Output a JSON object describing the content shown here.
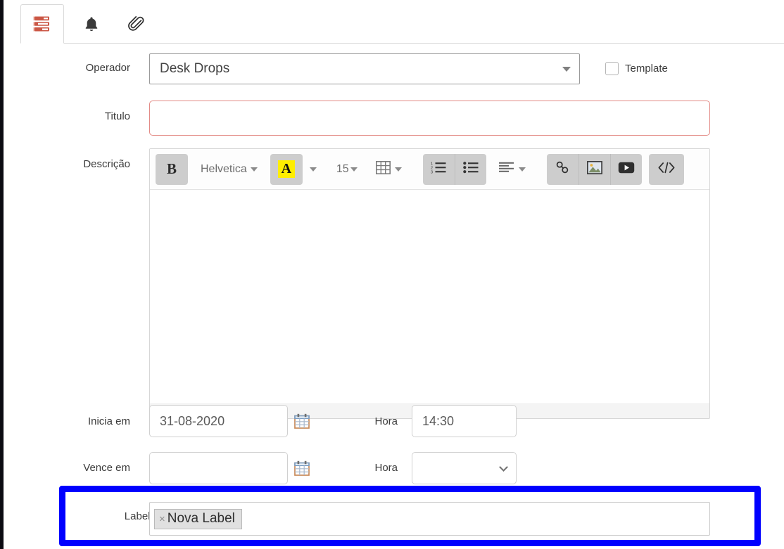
{
  "tabs": [
    {
      "id": "tab-details",
      "icon": "server-stack-icon",
      "label": "",
      "active": true
    },
    {
      "id": "tab-notifications",
      "icon": "bell-icon",
      "label": "",
      "active": false
    },
    {
      "id": "tab-attachments",
      "icon": "paperclip-icon",
      "label": "",
      "active": false
    }
  ],
  "form": {
    "operador": {
      "label": "Operador",
      "value": "Desk Drops",
      "icon": "chevron-down-icon"
    },
    "template": {
      "label": "Template",
      "checked": false
    },
    "titulo": {
      "label": "Titulo",
      "value": "",
      "placeholder": "",
      "invalid": true
    },
    "descricao": {
      "label": "Descrição",
      "content": "",
      "toolbar": {
        "bold_label": "B",
        "font_family": "Helvetica",
        "font_family_caret": "caret-down-icon",
        "text_color_glyph": "A",
        "text_color_caret": "caret-down-icon",
        "font_size": "15",
        "font_size_caret": "caret-down-icon",
        "table_icon": "table-grid-icon",
        "table_caret": "caret-down-icon",
        "ordered_list_icon": "ordered-list-icon",
        "unordered_list_icon": "unordered-list-icon",
        "align_icon": "align-left-icon",
        "align_caret": "caret-down-icon",
        "link_icon": "link-chain-icon",
        "image_icon": "image-picture-icon",
        "video_icon": "video-play-icon",
        "code_icon": "code-brackets-icon",
        "code_label": "</>"
      },
      "resize_grip": "resize-grip-icon"
    },
    "inicia_em": {
      "label": "Inicia em",
      "value": "31-08-2020",
      "calendar_icon": "calendar-icon",
      "hora_label": "Hora",
      "hora_value": "14:30"
    },
    "vence_em": {
      "label": "Vence em",
      "value": "",
      "calendar_icon": "calendar-icon",
      "hora_label": "Hora",
      "hora_value": "",
      "hora_caret": "chevron-down-icon"
    },
    "labels": {
      "label": "Labels",
      "chips": [
        {
          "remove_glyph": "×",
          "text": "Nova Label"
        }
      ]
    }
  },
  "annotation": {
    "highlight_color": "#0000ff",
    "target": "labels-field"
  }
}
